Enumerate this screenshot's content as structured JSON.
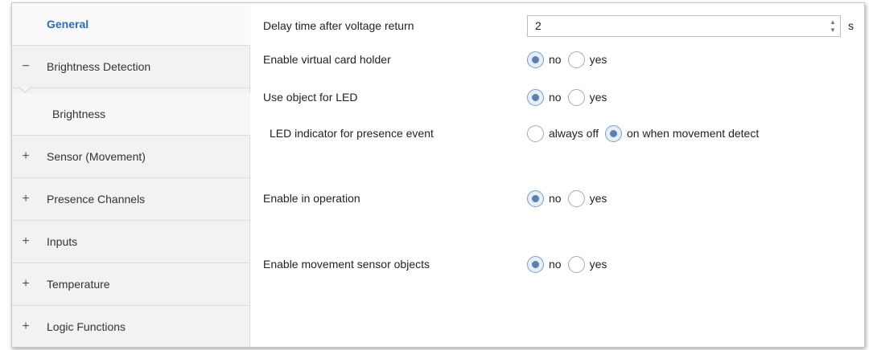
{
  "sidebar": {
    "items": [
      {
        "sign": "",
        "label": "General"
      },
      {
        "sign": "−",
        "label": "Brightness Detection"
      },
      {
        "sign": "",
        "label": "Brightness"
      },
      {
        "sign": "+",
        "label": "Sensor (Movement)"
      },
      {
        "sign": "+",
        "label": "Presence Channels"
      },
      {
        "sign": "+",
        "label": "Inputs"
      },
      {
        "sign": "+",
        "label": "Temperature"
      },
      {
        "sign": "+",
        "label": "Logic Functions"
      }
    ]
  },
  "params": {
    "delay": {
      "label": "Delay time after voltage return",
      "value": "2",
      "unit": "s"
    },
    "card_holder": {
      "label": "Enable virtual card holder",
      "opt1": "no",
      "opt2": "yes"
    },
    "led_object": {
      "label": "Use object for LED",
      "opt1": "no",
      "opt2": "yes"
    },
    "led_indicator": {
      "label": "LED indicator for presence event",
      "opt1": "always off",
      "opt2": "on when movement detect"
    },
    "in_operation": {
      "label": "Enable in operation",
      "opt1": "no",
      "opt2": "yes"
    },
    "movement_objects": {
      "label": "Enable movement sensor objects",
      "opt1": "no",
      "opt2": "yes"
    }
  },
  "colors": {
    "accent": "#2f6db3",
    "sidebar_bg": "#f2f2f2",
    "radio_checked": "#5b7fb0"
  }
}
